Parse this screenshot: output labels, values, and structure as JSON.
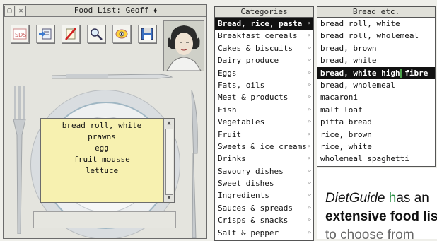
{
  "food_window": {
    "title": "Food List: Geoff ⬧",
    "toolbar_icons": [
      "sds-icon",
      "add-list-icon",
      "delete-icon",
      "magnify-icon",
      "eye-icon",
      "save-disk-icon"
    ],
    "items": [
      "bread roll, white",
      "prawns",
      "egg",
      "fruit mousse",
      "lettuce"
    ]
  },
  "categories_menu": {
    "title": "Categories",
    "selected_index": 0,
    "items": [
      "Bread, rice, pasta",
      "Breakfast cereals",
      "Cakes & biscuits",
      "Dairy produce",
      "Eggs",
      "Fats, oils",
      "Meat & products",
      "Fish",
      "Vegetables",
      "Fruit",
      "Sweets & ice creams",
      "Drinks",
      "Savoury dishes",
      "Sweet dishes",
      "Ingredients",
      "Sauces & spreads",
      "Crisps & snacks",
      "Salt & pepper"
    ]
  },
  "bread_menu": {
    "title": "Bread etc.",
    "selected_index": 4,
    "items": [
      "bread roll, white",
      "bread roll, wholemeal",
      "bread, brown",
      "bread, white",
      "bread, white high fibre",
      "bread, wholemeal",
      "macaroni",
      "malt loaf",
      "pitta bread",
      "rice, brown",
      "rice, white",
      "wholemeal spaghetti"
    ]
  },
  "magazine": {
    "line1_italic": "DietGuide",
    "line1_accent": " h",
    "line1_rest": "as an",
    "line2": "extensive food list",
    "line3": "to choose from"
  },
  "colors": {
    "highlight": "#111111",
    "food_box": "#f7f1b0",
    "accent": "#1f8a3c"
  }
}
